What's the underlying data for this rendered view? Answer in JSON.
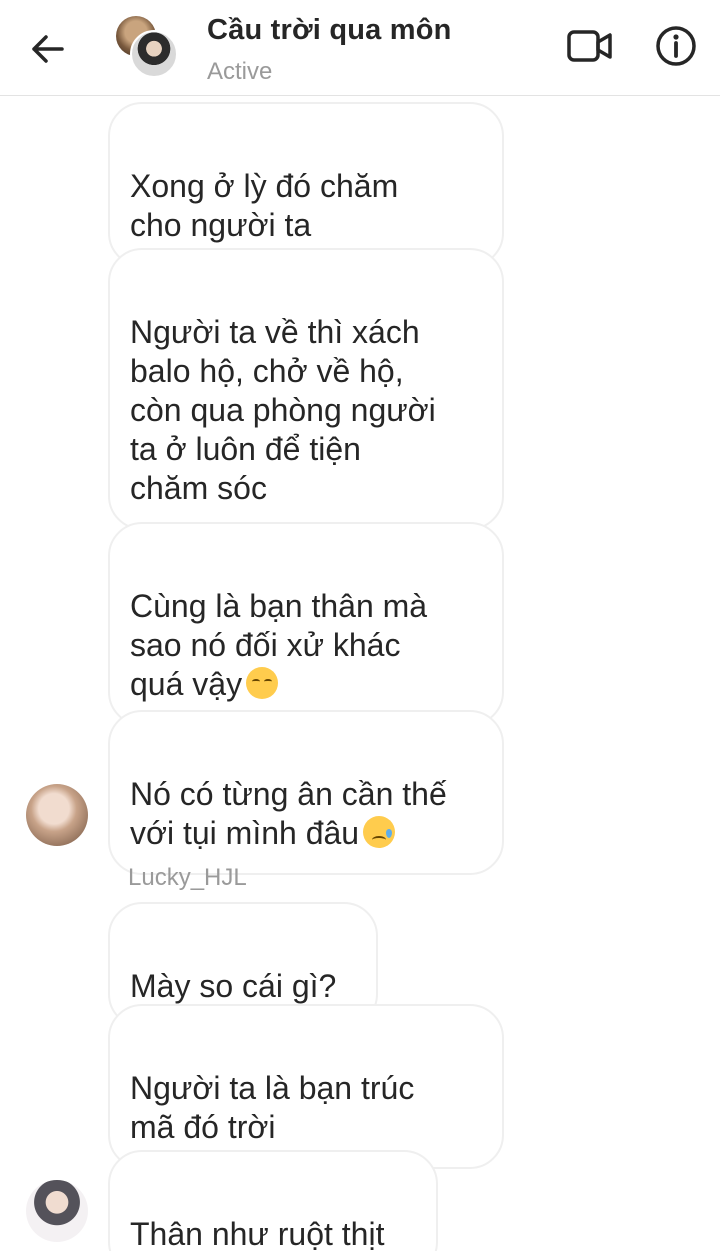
{
  "header": {
    "title": "Cầu trời qua môn",
    "status": "Active",
    "back_icon": "arrow-left-icon",
    "video_icon": "video-camera-icon",
    "info_icon": "info-icon"
  },
  "messages": [
    {
      "text": "Xong ở lỳ đó chăm\ncho người ta"
    },
    {
      "text": "Người ta về thì xách\nbalo hộ, chở về hộ,\ncòn qua phòng người\nta ở luôn để tiện\nchăm sóc"
    },
    {
      "text": "Cùng là bạn thân mà\nsao nó đối xử khác\nquá vậy",
      "emoji": "pensive-face"
    },
    {
      "text": "Nó có từng ân cần thế\nvới tụi mình đâu",
      "emoji": "sad-but-relieved-face"
    },
    {
      "text": "Mày so cái gì?"
    },
    {
      "text": "Người ta là bạn trúc\nmã đó trời"
    },
    {
      "text": "Thân như ruột thịt"
    }
  ],
  "sender_name": "Lucky_HJL",
  "colors": {
    "bubble_border": "#efefef",
    "text": "#262626",
    "muted": "#9a9a9a",
    "emoji": "#ffcc4d"
  }
}
